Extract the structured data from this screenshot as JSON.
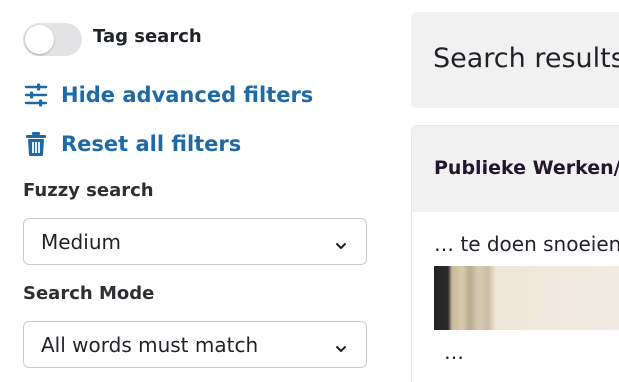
{
  "toggle": {
    "label": "Tag search",
    "on": false
  },
  "actions": {
    "hide_filters": {
      "label": "Hide advanced filters",
      "icon": "sliders-icon"
    },
    "reset_filters": {
      "label": "Reset all filters",
      "icon": "trash-icon"
    }
  },
  "fields": {
    "fuzzy": {
      "label": "Fuzzy search",
      "value": "Medium"
    },
    "mode": {
      "label": "Search Mode",
      "value": "All words must match"
    }
  },
  "results": {
    "title": "Search results",
    "items": [
      {
        "title": "Publieke Werken/",
        "snippet": "… te doen snoeien",
        "more": "…"
      }
    ]
  },
  "colors": {
    "link": "#1f6aa5",
    "panel": "#f1f1f2",
    "toggle_off": "#e3e3e5"
  }
}
